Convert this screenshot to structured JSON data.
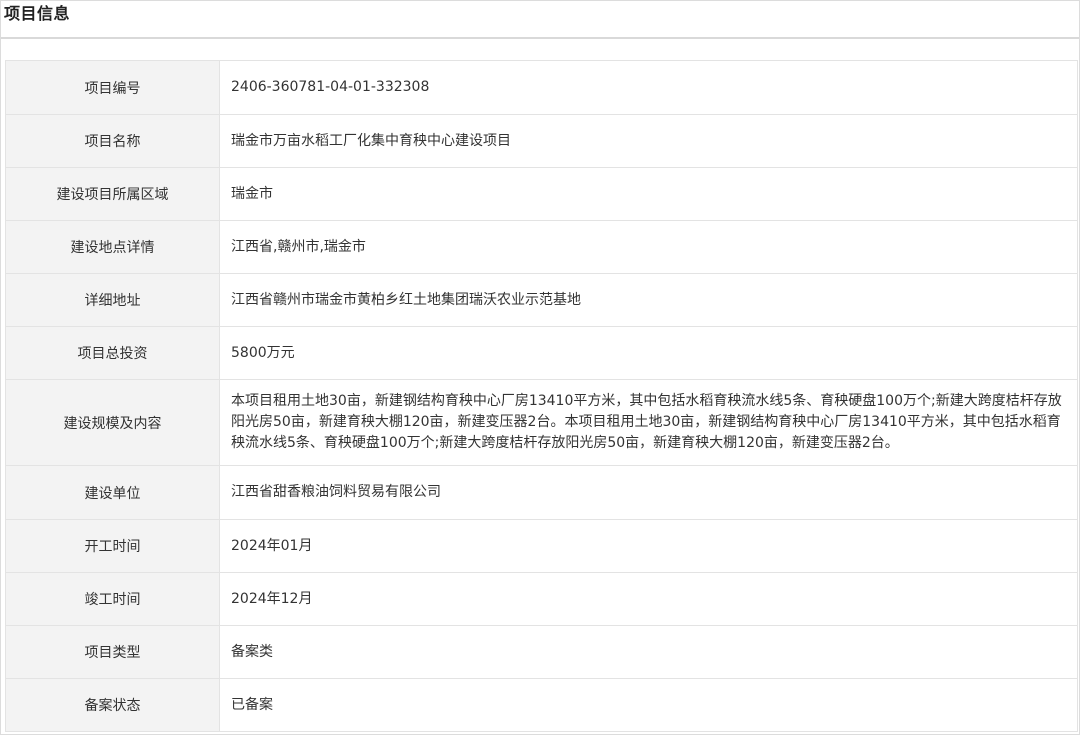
{
  "panel": {
    "title": "项目信息"
  },
  "rows": [
    {
      "label": "项目编号",
      "value": "2406-360781-04-01-332308"
    },
    {
      "label": "项目名称",
      "value": "瑞金市万亩水稻工厂化集中育秧中心建设项目"
    },
    {
      "label": "建设项目所属区域",
      "value": "瑞金市"
    },
    {
      "label": "建设地点详情",
      "value": "江西省,赣州市,瑞金市"
    },
    {
      "label": "详细地址",
      "value": "江西省赣州市瑞金市黄柏乡红土地集团瑞沃农业示范基地"
    },
    {
      "label": "项目总投资",
      "value": "5800万元"
    },
    {
      "label": "建设规模及内容",
      "value": "本项目租用土地30亩，新建钢结构育秧中心厂房13410平方米，其中包括水稻育秧流水线5条、育秧硬盘100万个;新建大跨度桔杆存放阳光房50亩，新建育秧大棚120亩，新建变压器2台。本项目租用土地30亩，新建钢结构育秧中心厂房13410平方米，其中包括水稻育秧流水线5条、育秧硬盘100万个;新建大跨度桔杆存放阳光房50亩，新建育秧大棚120亩，新建变压器2台。"
    },
    {
      "label": "建设单位",
      "value": "江西省甜香粮油饲料贸易有限公司"
    },
    {
      "label": "开工时间",
      "value": "2024年01月"
    },
    {
      "label": "竣工时间",
      "value": "2024年12月"
    },
    {
      "label": "项目类型",
      "value": "备案类"
    },
    {
      "label": "备案状态",
      "value": "已备案"
    }
  ]
}
